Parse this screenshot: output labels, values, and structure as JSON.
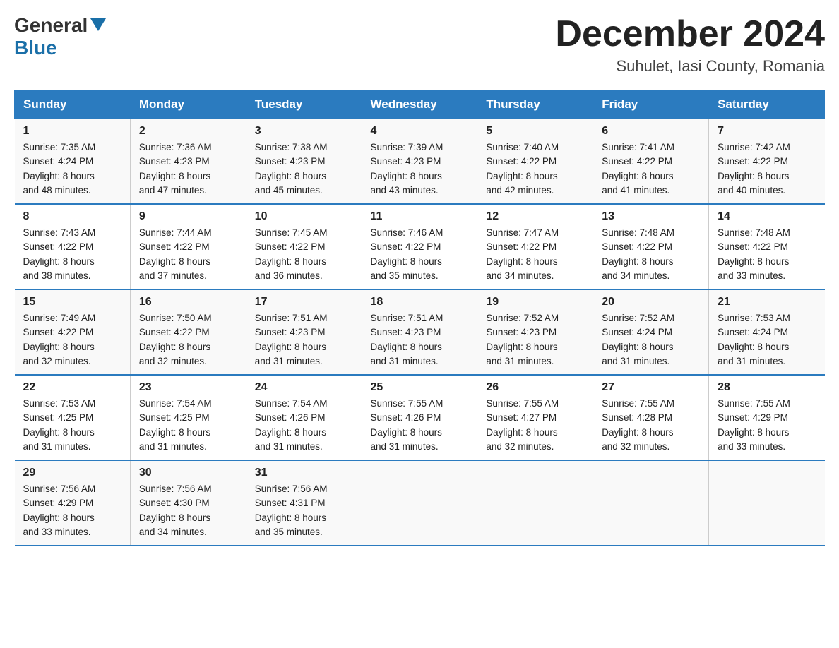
{
  "header": {
    "logo": {
      "general": "General",
      "blue": "Blue",
      "arrow": "▲"
    },
    "title": "December 2024",
    "location": "Suhulet, Iasi County, Romania"
  },
  "columns": [
    "Sunday",
    "Monday",
    "Tuesday",
    "Wednesday",
    "Thursday",
    "Friday",
    "Saturday"
  ],
  "weeks": [
    [
      {
        "day": "1",
        "sunrise": "7:35 AM",
        "sunset": "4:24 PM",
        "daylight": "8 hours and 48 minutes."
      },
      {
        "day": "2",
        "sunrise": "7:36 AM",
        "sunset": "4:23 PM",
        "daylight": "8 hours and 47 minutes."
      },
      {
        "day": "3",
        "sunrise": "7:38 AM",
        "sunset": "4:23 PM",
        "daylight": "8 hours and 45 minutes."
      },
      {
        "day": "4",
        "sunrise": "7:39 AM",
        "sunset": "4:23 PM",
        "daylight": "8 hours and 43 minutes."
      },
      {
        "day": "5",
        "sunrise": "7:40 AM",
        "sunset": "4:22 PM",
        "daylight": "8 hours and 42 minutes."
      },
      {
        "day": "6",
        "sunrise": "7:41 AM",
        "sunset": "4:22 PM",
        "daylight": "8 hours and 41 minutes."
      },
      {
        "day": "7",
        "sunrise": "7:42 AM",
        "sunset": "4:22 PM",
        "daylight": "8 hours and 40 minutes."
      }
    ],
    [
      {
        "day": "8",
        "sunrise": "7:43 AM",
        "sunset": "4:22 PM",
        "daylight": "8 hours and 38 minutes."
      },
      {
        "day": "9",
        "sunrise": "7:44 AM",
        "sunset": "4:22 PM",
        "daylight": "8 hours and 37 minutes."
      },
      {
        "day": "10",
        "sunrise": "7:45 AM",
        "sunset": "4:22 PM",
        "daylight": "8 hours and 36 minutes."
      },
      {
        "day": "11",
        "sunrise": "7:46 AM",
        "sunset": "4:22 PM",
        "daylight": "8 hours and 35 minutes."
      },
      {
        "day": "12",
        "sunrise": "7:47 AM",
        "sunset": "4:22 PM",
        "daylight": "8 hours and 34 minutes."
      },
      {
        "day": "13",
        "sunrise": "7:48 AM",
        "sunset": "4:22 PM",
        "daylight": "8 hours and 34 minutes."
      },
      {
        "day": "14",
        "sunrise": "7:48 AM",
        "sunset": "4:22 PM",
        "daylight": "8 hours and 33 minutes."
      }
    ],
    [
      {
        "day": "15",
        "sunrise": "7:49 AM",
        "sunset": "4:22 PM",
        "daylight": "8 hours and 32 minutes."
      },
      {
        "day": "16",
        "sunrise": "7:50 AM",
        "sunset": "4:22 PM",
        "daylight": "8 hours and 32 minutes."
      },
      {
        "day": "17",
        "sunrise": "7:51 AM",
        "sunset": "4:23 PM",
        "daylight": "8 hours and 31 minutes."
      },
      {
        "day": "18",
        "sunrise": "7:51 AM",
        "sunset": "4:23 PM",
        "daylight": "8 hours and 31 minutes."
      },
      {
        "day": "19",
        "sunrise": "7:52 AM",
        "sunset": "4:23 PM",
        "daylight": "8 hours and 31 minutes."
      },
      {
        "day": "20",
        "sunrise": "7:52 AM",
        "sunset": "4:24 PM",
        "daylight": "8 hours and 31 minutes."
      },
      {
        "day": "21",
        "sunrise": "7:53 AM",
        "sunset": "4:24 PM",
        "daylight": "8 hours and 31 minutes."
      }
    ],
    [
      {
        "day": "22",
        "sunrise": "7:53 AM",
        "sunset": "4:25 PM",
        "daylight": "8 hours and 31 minutes."
      },
      {
        "day": "23",
        "sunrise": "7:54 AM",
        "sunset": "4:25 PM",
        "daylight": "8 hours and 31 minutes."
      },
      {
        "day": "24",
        "sunrise": "7:54 AM",
        "sunset": "4:26 PM",
        "daylight": "8 hours and 31 minutes."
      },
      {
        "day": "25",
        "sunrise": "7:55 AM",
        "sunset": "4:26 PM",
        "daylight": "8 hours and 31 minutes."
      },
      {
        "day": "26",
        "sunrise": "7:55 AM",
        "sunset": "4:27 PM",
        "daylight": "8 hours and 32 minutes."
      },
      {
        "day": "27",
        "sunrise": "7:55 AM",
        "sunset": "4:28 PM",
        "daylight": "8 hours and 32 minutes."
      },
      {
        "day": "28",
        "sunrise": "7:55 AM",
        "sunset": "4:29 PM",
        "daylight": "8 hours and 33 minutes."
      }
    ],
    [
      {
        "day": "29",
        "sunrise": "7:56 AM",
        "sunset": "4:29 PM",
        "daylight": "8 hours and 33 minutes."
      },
      {
        "day": "30",
        "sunrise": "7:56 AM",
        "sunset": "4:30 PM",
        "daylight": "8 hours and 34 minutes."
      },
      {
        "day": "31",
        "sunrise": "7:56 AM",
        "sunset": "4:31 PM",
        "daylight": "8 hours and 35 minutes."
      },
      null,
      null,
      null,
      null
    ]
  ]
}
